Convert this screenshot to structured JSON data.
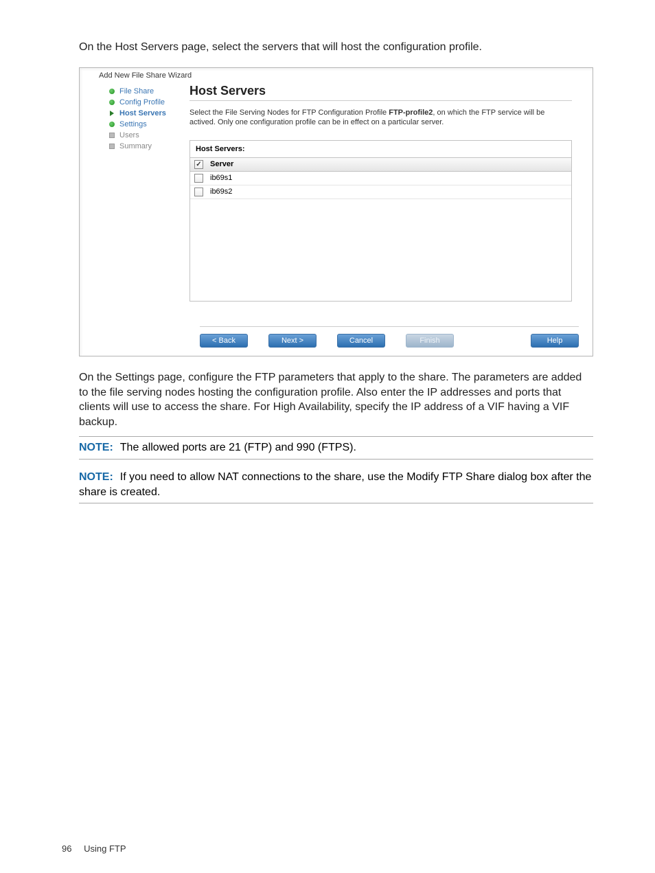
{
  "intro_text": "On the Host Servers page, select the servers that will host the configuration profile.",
  "wizard": {
    "title": "Add New File Share Wizard",
    "sidebar": {
      "items": [
        {
          "label": "File Share",
          "state": "complete"
        },
        {
          "label": "Config Profile",
          "state": "complete"
        },
        {
          "label": "Host Servers",
          "state": "current"
        },
        {
          "label": "Settings",
          "state": "complete"
        },
        {
          "label": "Users",
          "state": "pending"
        },
        {
          "label": "Summary",
          "state": "pending"
        }
      ]
    },
    "heading": "Host Servers",
    "description_prefix": "Select the File Serving Nodes for FTP Configuration Profile ",
    "description_bold": "FTP-profile2",
    "description_suffix": ", on which the FTP service will be actived. Only one configuration profile can be in effect on a particular server.",
    "host_servers_label": "Host Servers:",
    "table": {
      "header_checked": true,
      "header_label": "Server",
      "rows": [
        {
          "checked": false,
          "name": "ib69s1"
        },
        {
          "checked": false,
          "name": "ib69s2"
        }
      ]
    },
    "buttons": {
      "back": "< Back",
      "next": "Next >",
      "cancel": "Cancel",
      "finish": "Finish",
      "help": "Help"
    }
  },
  "settings_paragraph": "On the Settings page, configure the FTP parameters that apply to the share. The parameters are added to the file serving nodes hosting the configuration profile. Also enter the IP addresses and ports that clients will use to access the share. For High Availability, specify the IP address of a VIF having a VIF backup.",
  "notes": [
    {
      "label": "NOTE:",
      "text": "The allowed ports are 21 (FTP) and 990 (FTPS)."
    },
    {
      "label": "NOTE:",
      "text": "If you need to allow NAT connections to the share, use the Modify FTP Share dialog box after the share is created."
    }
  ],
  "footer": {
    "page": "96",
    "section": "Using FTP"
  }
}
